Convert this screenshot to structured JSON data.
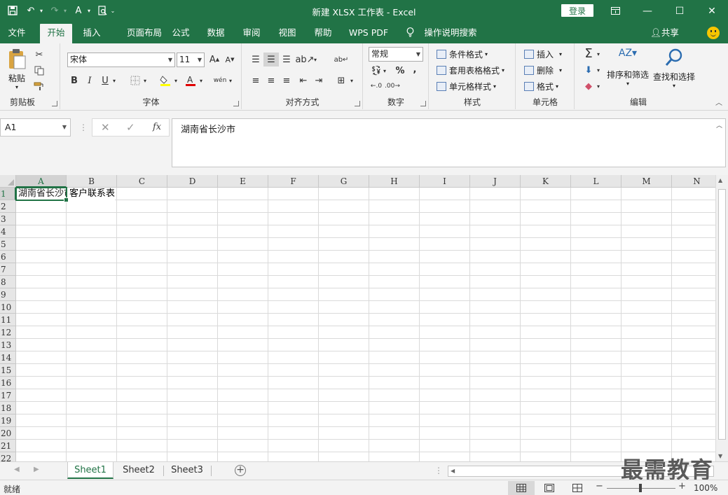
{
  "window": {
    "title": "新建 XLSX 工作表  -  Excel",
    "login_label": "登录"
  },
  "tabs": [
    "文件",
    "开始",
    "插入",
    "页面布局",
    "公式",
    "数据",
    "审阅",
    "视图",
    "帮助",
    "WPS PDF",
    "操作说明搜索"
  ],
  "active_tab": "开始",
  "share_label": "共享",
  "ribbon": {
    "clipboard": {
      "paste": "粘贴",
      "label": "剪贴板"
    },
    "font": {
      "name": "宋体",
      "size": "11",
      "label": "字体",
      "bold": "B",
      "italic": "I",
      "underline": "U"
    },
    "alignment": {
      "label": "对齐方式"
    },
    "number": {
      "format": "常规",
      "label": "数字",
      "percent": "%",
      "comma": ","
    },
    "styles": {
      "conditional": "条件格式",
      "table": "套用表格格式",
      "cell_styles": "单元格样式",
      "label": "样式"
    },
    "cells": {
      "insert": "插入",
      "delete": "删除",
      "format": "格式",
      "label": "单元格"
    },
    "editing": {
      "sort": "排序和筛选",
      "find": "查找和选择",
      "label": "编辑"
    }
  },
  "formula_bar": {
    "name_box": "A1",
    "fx": "fx",
    "content": "湖南省长沙市"
  },
  "columns": [
    "A",
    "B",
    "C",
    "D",
    "E",
    "F",
    "G",
    "H",
    "I",
    "J",
    "K",
    "L",
    "M",
    "N"
  ],
  "rows": [
    "1",
    "2",
    "3",
    "4",
    "5",
    "6",
    "7",
    "8",
    "9",
    "10",
    "11",
    "12",
    "13",
    "14",
    "15",
    "16",
    "17",
    "18",
    "19",
    "20",
    "21",
    "22"
  ],
  "cells": {
    "A1": "湖南省长沙市",
    "B1": "客户联系表"
  },
  "sheets": [
    "Sheet1",
    "Sheet2",
    "Sheet3"
  ],
  "active_sheet": "Sheet1",
  "status": {
    "ready": "就绪",
    "zoom": "100%"
  },
  "watermark": "最需教育"
}
